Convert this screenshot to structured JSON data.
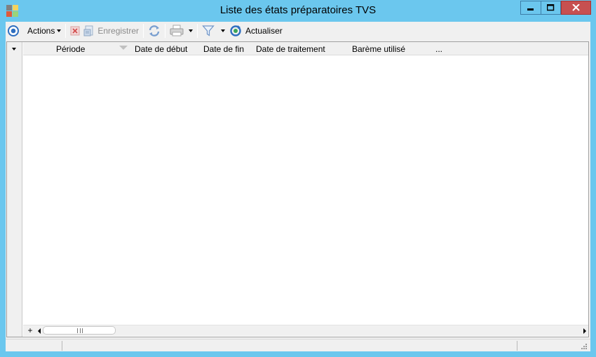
{
  "window": {
    "title": "Liste des états préparatoires TVS",
    "accent_color": "#6bc7ee",
    "close_color": "#c75050"
  },
  "toolbar": {
    "actions_label": "Actions",
    "save_label": "Enregistrer",
    "refresh_label": "Actualiser",
    "icons": [
      "nav-circle-icon",
      "delete-icon",
      "save-document-icon",
      "sync-icon",
      "print-icon",
      "filter-icon",
      "refresh-icon"
    ]
  },
  "grid": {
    "columns": [
      "Période",
      "Date de début",
      "Date de fin",
      "Date de traitement",
      "Barème utilisé",
      "..."
    ],
    "rows": []
  },
  "scroll": {
    "add_label": "+"
  }
}
